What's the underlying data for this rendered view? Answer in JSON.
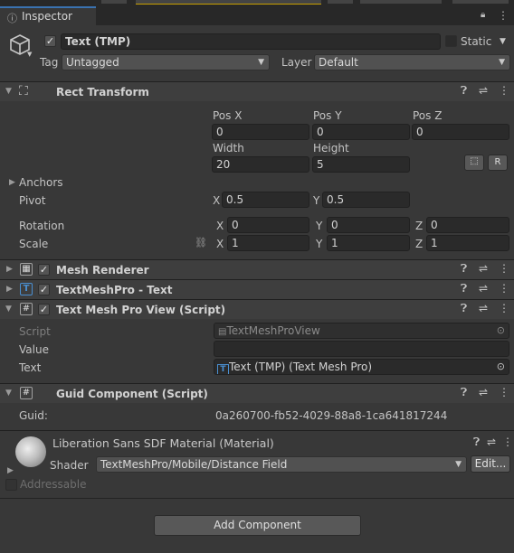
{
  "tab": {
    "title": "Inspector"
  },
  "object": {
    "name": "Text (TMP)",
    "active": true,
    "static_label": "Static",
    "tag_label": "Tag",
    "tag_value": "Untagged",
    "layer_label": "Layer",
    "layer_value": "Default"
  },
  "rect_transform": {
    "title": "Rect Transform",
    "pos_x_label": "Pos X",
    "pos_y_label": "Pos Y",
    "pos_z_label": "Pos Z",
    "pos_x": "0",
    "pos_y": "0",
    "pos_z": "0",
    "width_label": "Width",
    "height_label": "Height",
    "width": "20",
    "height": "5",
    "r_button": "R",
    "anchors_label": "Anchors",
    "pivot_label": "Pivot",
    "pivot_x": "0.5",
    "pivot_y": "0.5",
    "rotation_label": "Rotation",
    "rot_x": "0",
    "rot_y": "0",
    "rot_z": "0",
    "scale_label": "Scale",
    "scale_x": "1",
    "scale_y": "1",
    "scale_z": "1",
    "x": "X",
    "y": "Y",
    "z": "Z"
  },
  "components": {
    "mesh_renderer": "Mesh Renderer",
    "textmeshpro": "TextMeshPro - Text",
    "tmp_view": "Text Mesh Pro View (Script)",
    "guid_component": "Guid Component (Script)"
  },
  "tmp_view": {
    "script_label": "Script",
    "script_value": "TextMeshProView",
    "value_label": "Value",
    "value_value": "",
    "text_label": "Text",
    "text_value": "Text (TMP) (Text Mesh Pro)"
  },
  "guid": {
    "label": "Guid:",
    "value": "0a260700-fb52-4029-88a8-1ca641817244"
  },
  "material": {
    "title": "Liberation Sans SDF Material (Material)",
    "shader_label": "Shader",
    "shader_value": "TextMeshPro/Mobile/Distance Field",
    "edit_button": "Edit...",
    "addressable_label": "Addressable"
  },
  "add_component": "Add Component",
  "colors": {
    "background": "#383838",
    "header": "#3e3e3e",
    "field": "#2a2a2a",
    "accent_blue": "#4a8fd1"
  }
}
